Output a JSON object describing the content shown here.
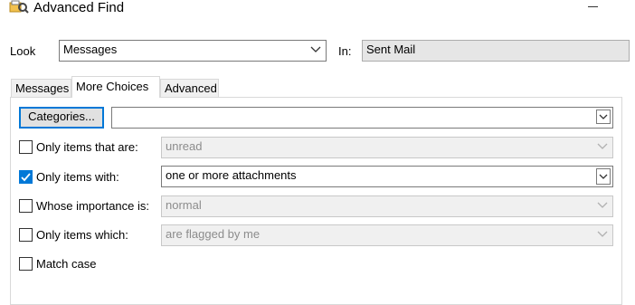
{
  "window": {
    "title": "Advanced Find",
    "icon": "find-icon"
  },
  "look": {
    "label": "Look",
    "value": "Messages"
  },
  "in": {
    "label": "In:",
    "value": "Sent Mail"
  },
  "tabs": [
    {
      "label": "Messages",
      "active": false
    },
    {
      "label": "More Choices",
      "active": true
    },
    {
      "label": "Advanced",
      "active": false
    }
  ],
  "categories": {
    "button_label": "Categories...",
    "value": ""
  },
  "options": [
    {
      "label": "Only items that are:",
      "checked": false,
      "value": "unread",
      "enabled": false
    },
    {
      "label": "Only items with:",
      "checked": true,
      "value": "one or more attachments",
      "enabled": true
    },
    {
      "label": "Whose importance is:",
      "checked": false,
      "value": "normal",
      "enabled": false
    },
    {
      "label": "Only items which:",
      "checked": false,
      "value": "are flagged by me",
      "enabled": false
    },
    {
      "label": "Match case",
      "checked": false
    }
  ],
  "colors": {
    "accent": "#0078d7",
    "disabled_text": "#8c8c8c"
  }
}
